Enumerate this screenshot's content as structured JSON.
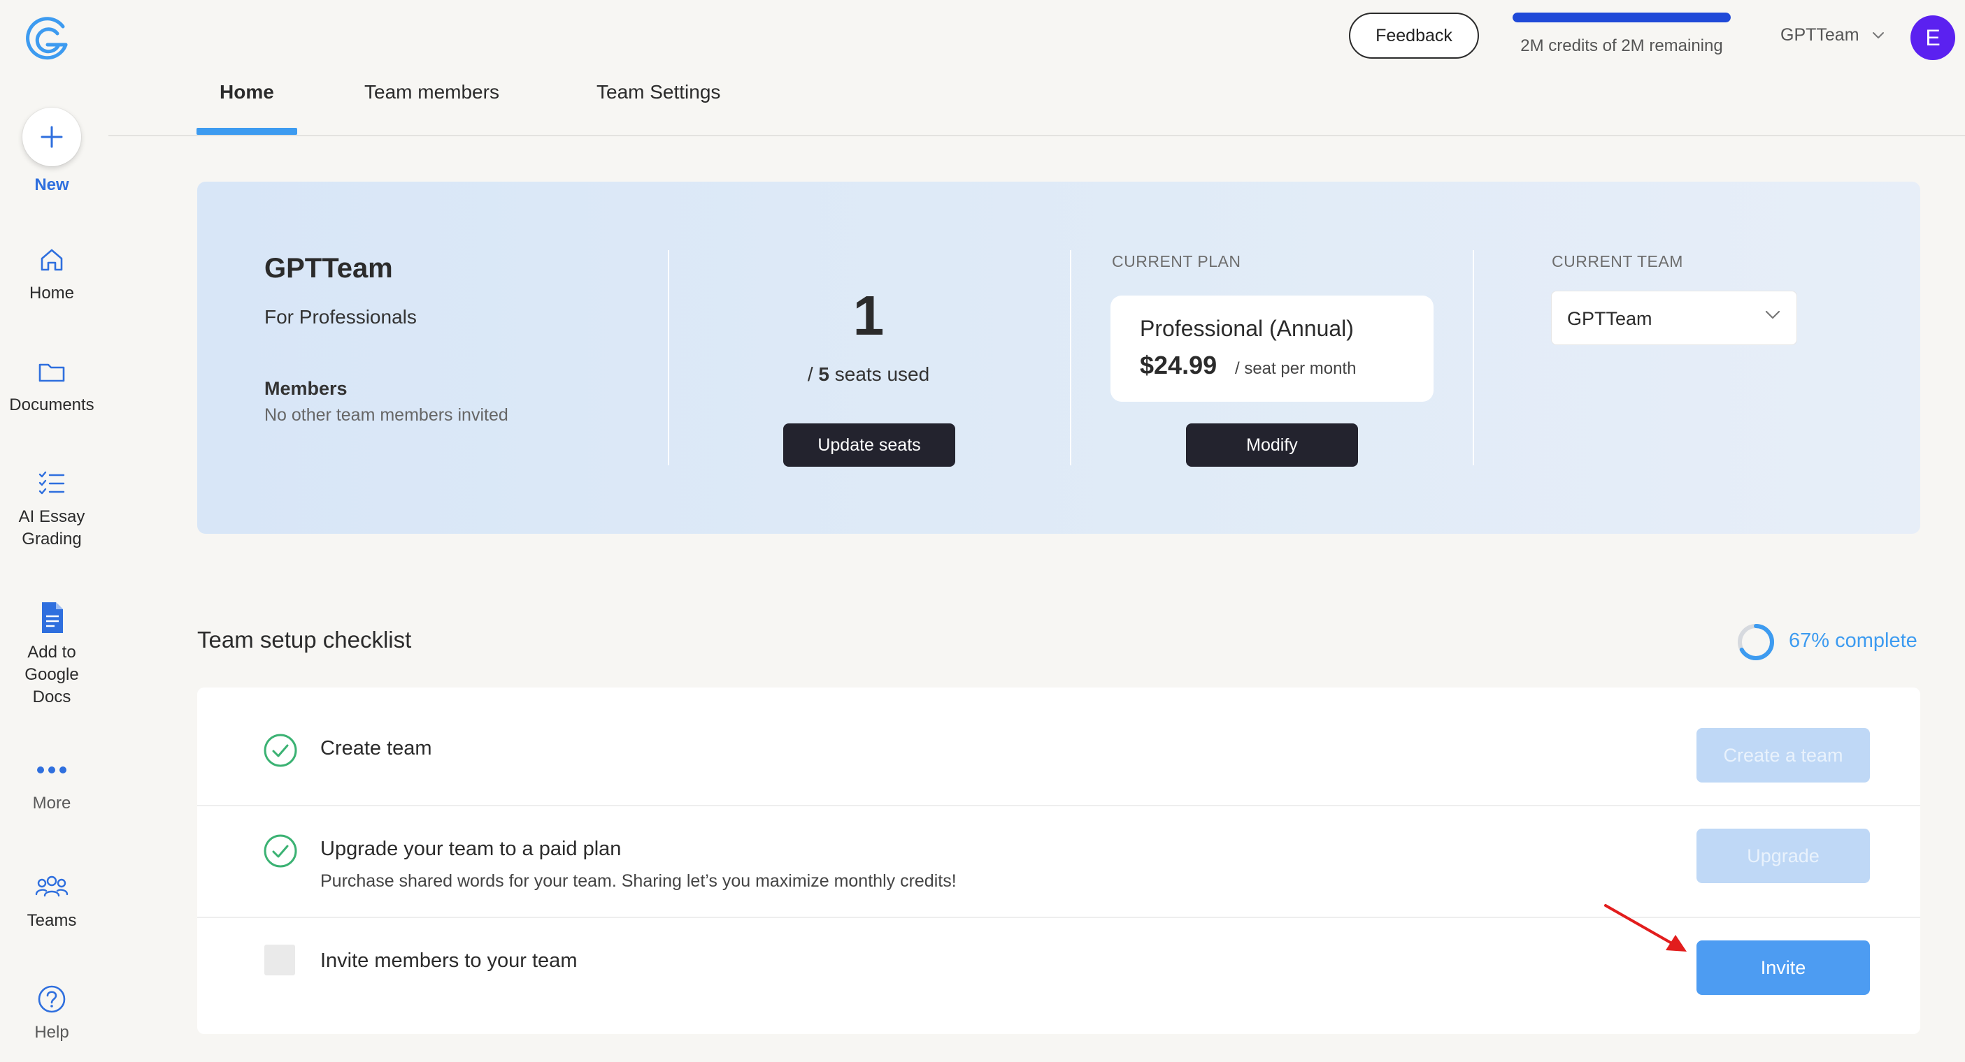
{
  "colors": {
    "accent": "#3d9bf0",
    "credits_fill": "#1f49d8",
    "avatar_bg": "#5b21f0",
    "dark_button": "#23232e",
    "check_green": "#3bb273",
    "arrow_red": "#e21d1d"
  },
  "sidebar": {
    "new_label": "New",
    "items": [
      {
        "label": "Home",
        "icon": "home-icon"
      },
      {
        "label": "Documents",
        "icon": "folder-icon"
      },
      {
        "label": "AI Essay Grading",
        "icon": "checklist-icon"
      },
      {
        "label": "Add to Google Docs",
        "icon": "google-docs-icon"
      },
      {
        "label": "More",
        "icon": "more-dots-icon"
      },
      {
        "label": "Teams",
        "icon": "teams-icon"
      },
      {
        "label": "Help",
        "icon": "help-icon"
      }
    ]
  },
  "header": {
    "feedback_label": "Feedback",
    "credits_text": "2M credits of 2M remaining",
    "credits_fraction": 1.0,
    "team_name": "GPTTeam",
    "avatar_initial": "E"
  },
  "tabs": [
    {
      "label": "Home",
      "active": true
    },
    {
      "label": "Team members",
      "active": false
    },
    {
      "label": "Team Settings",
      "active": false
    }
  ],
  "plan_card": {
    "team_name": "GPTTeam",
    "team_sub": "For Professionals",
    "members_heading": "Members",
    "members_sub": "No other team members invited",
    "seats_used": "1",
    "seats_text_prefix": "/ ",
    "seats_total": "5",
    "seats_text_suffix": " seats used",
    "update_seats_label": "Update seats",
    "current_plan_label": "CURRENT PLAN",
    "plan_name": "Professional (Annual)",
    "plan_price": "$24.99",
    "plan_per": "/ seat per month",
    "modify_label": "Modify",
    "current_team_label": "CURRENT TEAM",
    "current_team_value": "GPTTeam"
  },
  "checklist": {
    "title": "Team setup checklist",
    "progress_text": "67% complete",
    "progress_fraction": 0.67,
    "items": [
      {
        "title": "Create team",
        "sub": "",
        "done": true,
        "button": "Create a team"
      },
      {
        "title": "Upgrade your team to a paid plan",
        "sub": "Purchase shared words for your team. Sharing let’s you maximize monthly credits!",
        "done": true,
        "button": "Upgrade"
      },
      {
        "title": "Invite members to your team",
        "sub": "",
        "done": false,
        "button": "Invite"
      }
    ]
  }
}
